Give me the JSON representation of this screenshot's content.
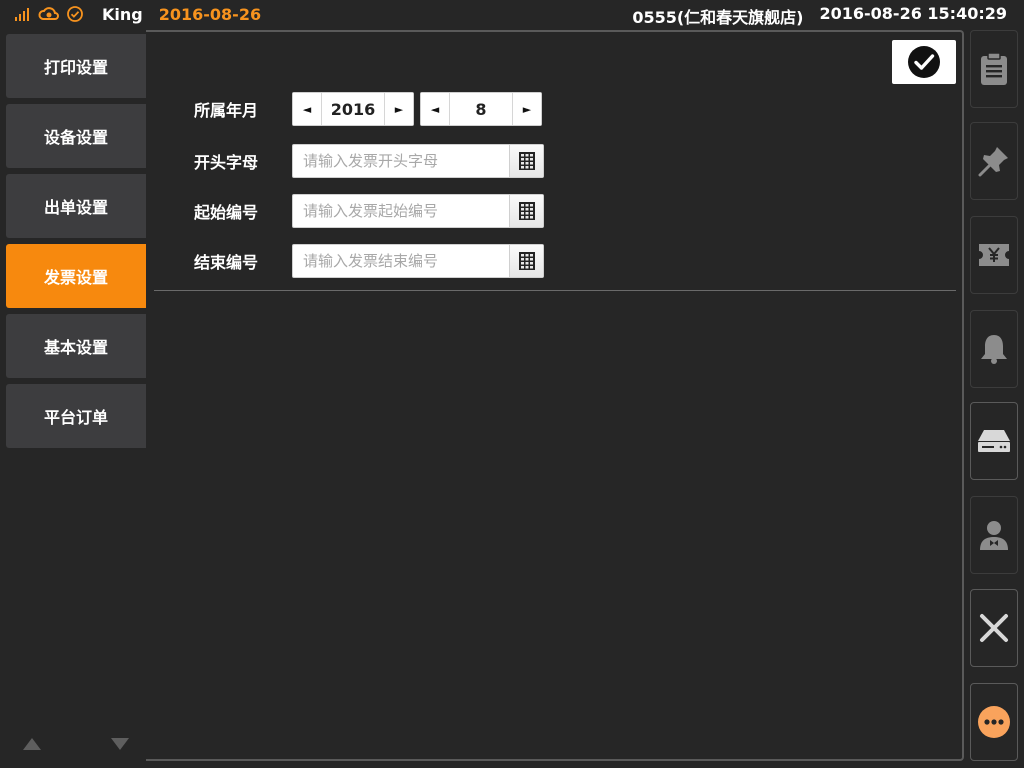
{
  "status_bar": {
    "user": "King",
    "date": "2016-08-26",
    "store": "0555(仁和春天旗舰店)",
    "datetime": "2016-08-26 15:40:29",
    "accent_color": "#f7931e"
  },
  "sidebar": {
    "items": [
      {
        "label": "打印设置",
        "active": false
      },
      {
        "label": "设备设置",
        "active": false
      },
      {
        "label": "出单设置",
        "active": false
      },
      {
        "label": "发票设置",
        "active": true
      },
      {
        "label": "基本设置",
        "active": false
      },
      {
        "label": "平台订单",
        "active": false
      }
    ],
    "active_color": "#f7890e"
  },
  "form": {
    "year_month": {
      "label": "所属年月",
      "year": "2016",
      "month": "8",
      "prev_glyph": "◄",
      "next_glyph": "►"
    },
    "prefix": {
      "label": "开头字母",
      "placeholder": "请输入发票开头字母",
      "value": ""
    },
    "start_no": {
      "label": "起始编号",
      "placeholder": "请输入发票起始编号",
      "value": ""
    },
    "end_no": {
      "label": "结束编号",
      "placeholder": "请输入发票结束编号",
      "value": ""
    }
  },
  "right_rail": {
    "icons": [
      "clipboard-icon",
      "pin-icon",
      "ticket-yen-icon",
      "bell-icon",
      "drive-icon",
      "waiter-icon",
      "close-icon",
      "more-icon"
    ],
    "more_color": "#f9a35c"
  }
}
